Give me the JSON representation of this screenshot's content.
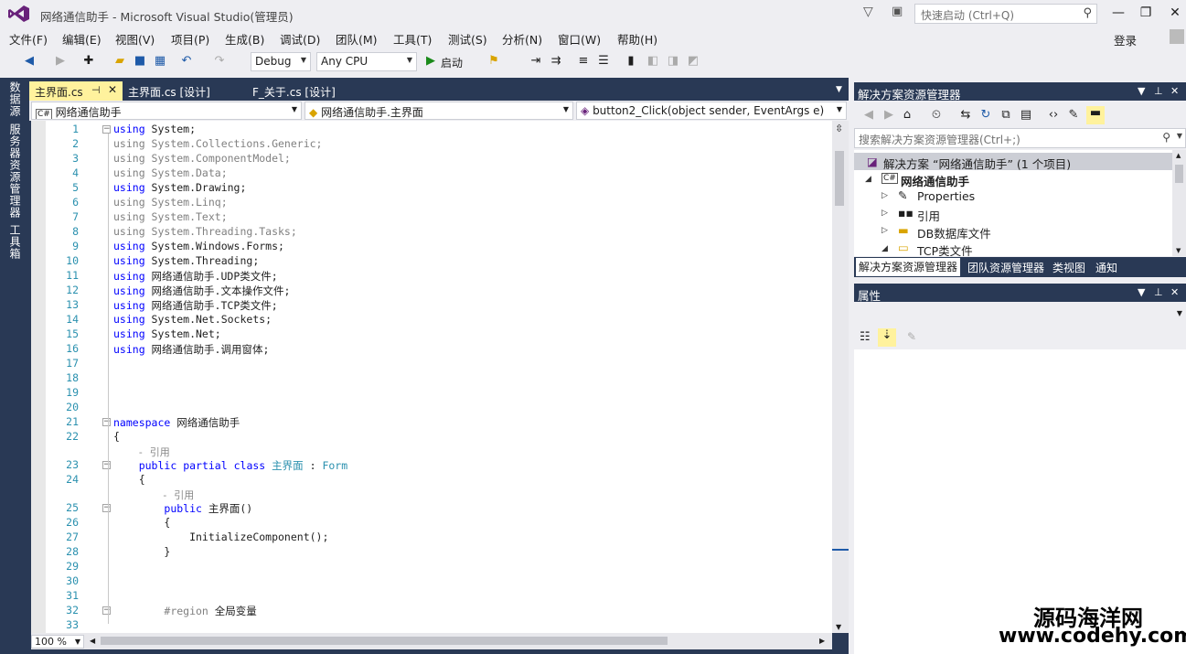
{
  "window": {
    "title": "网络通信助手 - Microsoft Visual Studio(管理员)",
    "quick_launch_placeholder": "快速启动 (Ctrl+Q)",
    "login": "登录"
  },
  "menu": [
    "文件(F)",
    "编辑(E)",
    "视图(V)",
    "项目(P)",
    "生成(B)",
    "调试(D)",
    "团队(M)",
    "工具(T)",
    "测试(S)",
    "分析(N)",
    "窗口(W)",
    "帮助(H)"
  ],
  "toolbar": {
    "config": "Debug",
    "platform": "Any CPU",
    "start_label": "启动"
  },
  "left_strip": [
    "数据源",
    "服务器资源管理器",
    "工具箱"
  ],
  "doc_tabs": [
    {
      "label": "主界面.cs",
      "active": true
    },
    {
      "label": "主界面.cs [设计]",
      "active": false
    },
    {
      "label": "F_关于.cs [设计]",
      "active": false
    }
  ],
  "nav": {
    "project": "网络通信助手",
    "class": "网络通信助手.主界面",
    "member": "button2_Click(object sender, EventArgs e)"
  },
  "code_lines": [
    {
      "n": "1",
      "t": "using System;"
    },
    {
      "n": "2",
      "t": "using System.Collections.Generic;"
    },
    {
      "n": "3",
      "t": "using System.ComponentModel;"
    },
    {
      "n": "4",
      "t": "using System.Data;"
    },
    {
      "n": "5",
      "t": "using System.Drawing;"
    },
    {
      "n": "6",
      "t": "using System.Linq;"
    },
    {
      "n": "7",
      "t": "using System.Text;"
    },
    {
      "n": "8",
      "t": "using System.Threading.Tasks;"
    },
    {
      "n": "9",
      "t": "using System.Windows.Forms;"
    },
    {
      "n": "10",
      "t": "using System.Threading;"
    },
    {
      "n": "11",
      "t": "using 网络通信助手.UDP类文件;"
    },
    {
      "n": "12",
      "t": "using 网络通信助手.文本操作文件;"
    },
    {
      "n": "13",
      "t": "using 网络通信助手.TCP类文件;"
    },
    {
      "n": "14",
      "t": "using System.Net.Sockets;"
    },
    {
      "n": "15",
      "t": "using System.Net;"
    },
    {
      "n": "16",
      "t": "using 网络通信助手.调用窗体;"
    },
    {
      "n": "17",
      "t": ""
    },
    {
      "n": "18",
      "t": ""
    },
    {
      "n": "19",
      "t": ""
    },
    {
      "n": "20",
      "t": ""
    },
    {
      "n": "21",
      "t": "namespace 网络通信助手"
    },
    {
      "n": "22",
      "t": "{"
    },
    {
      "n": "",
      "t": "    - 引用"
    },
    {
      "n": "23",
      "t": "    public partial class 主界面 : Form"
    },
    {
      "n": "24",
      "t": "    {"
    },
    {
      "n": "",
      "t": "        - 引用"
    },
    {
      "n": "25",
      "t": "        public 主界面()"
    },
    {
      "n": "26",
      "t": "        {"
    },
    {
      "n": "27",
      "t": "            InitializeComponent();"
    },
    {
      "n": "28",
      "t": "        }"
    },
    {
      "n": "29",
      "t": ""
    },
    {
      "n": "30",
      "t": ""
    },
    {
      "n": "31",
      "t": ""
    },
    {
      "n": "32",
      "t": "        #region 全局变量"
    },
    {
      "n": "33",
      "t": ""
    }
  ],
  "zoom": "100 %",
  "solution_explorer": {
    "title": "解决方案资源管理器",
    "search_placeholder": "搜索解决方案资源管理器(Ctrl+;)",
    "items": [
      {
        "label": "解决方案 “网络通信助手” (1 个项目)",
        "level": 0
      },
      {
        "label": "网络通信助手",
        "level": 1
      },
      {
        "label": "Properties",
        "level": 2
      },
      {
        "label": "引用",
        "level": 2
      },
      {
        "label": "DB数据库文件",
        "level": 2
      },
      {
        "label": "TCP类文件",
        "level": 2
      }
    ],
    "tabs": [
      "解决方案资源管理器",
      "团队资源管理器",
      "类视图",
      "通知"
    ]
  },
  "properties": {
    "title": "属性"
  },
  "watermark": {
    "line1": "源码海洋网",
    "line2": "www.codehy.com"
  }
}
